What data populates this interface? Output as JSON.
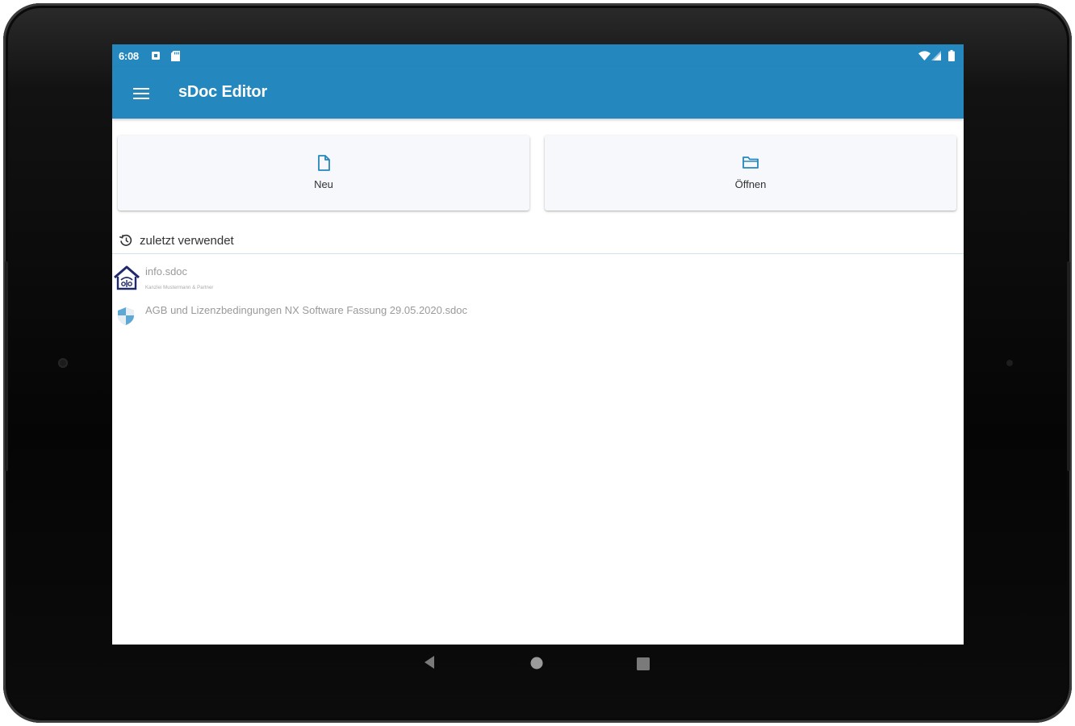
{
  "status_bar": {
    "time": "6:08",
    "left_icons": [
      "notification-icon",
      "sd-card-icon"
    ],
    "right_icons": [
      "wifi-icon",
      "signal-icon",
      "battery-icon"
    ]
  },
  "app_bar": {
    "title": "sDoc Editor",
    "menu_icon": "hamburger-menu-icon",
    "color": "#2487bd"
  },
  "actions": [
    {
      "label": "Neu",
      "icon": "new-document-icon"
    },
    {
      "label": "Öffnen",
      "icon": "folder-icon"
    }
  ],
  "recent": {
    "heading": "zuletzt verwendet",
    "icon": "history-icon",
    "files": [
      {
        "name": "info.sdoc",
        "subtitle": "Kanzlei Mustermann & Partner",
        "icon": "firm-logo-icon"
      },
      {
        "name": "AGB und Lizenzbedingungen NX Software Fassung 29.05.2020.sdoc",
        "icon": "shield-icon"
      }
    ]
  },
  "navigation": [
    "back-icon",
    "home-icon",
    "recents-icon"
  ]
}
